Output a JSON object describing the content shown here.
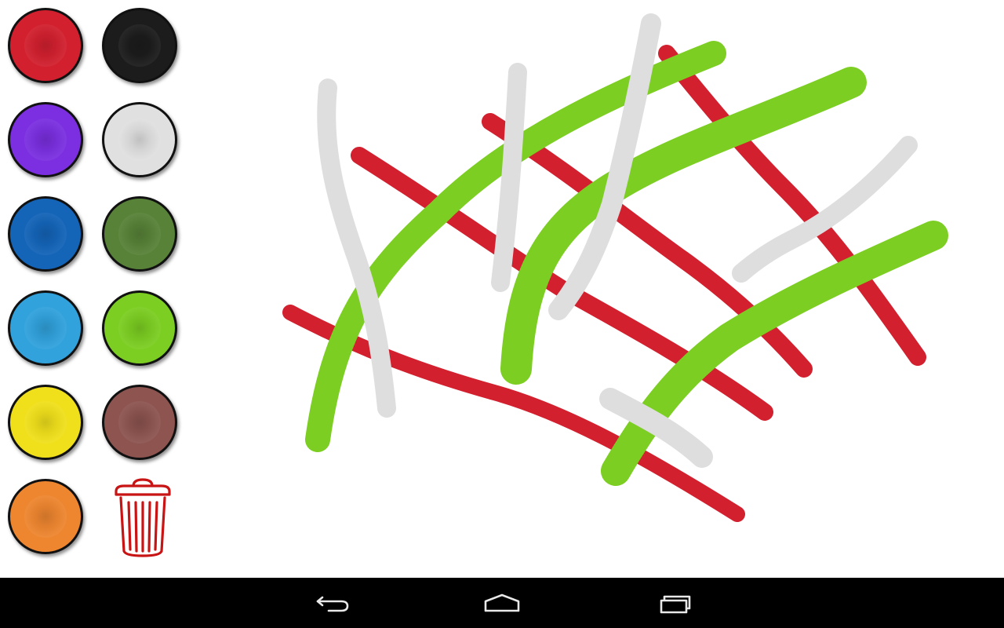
{
  "palette": {
    "colors": [
      {
        "name": "red",
        "hex": "#d2202f"
      },
      {
        "name": "black",
        "hex": "#1c1c1c"
      },
      {
        "name": "purple",
        "hex": "#7b2fe0"
      },
      {
        "name": "light-gray",
        "hex": "#e0e0e0"
      },
      {
        "name": "dark-blue",
        "hex": "#1464b8"
      },
      {
        "name": "olive-green",
        "hex": "#588238"
      },
      {
        "name": "sky-blue",
        "hex": "#31a2dc"
      },
      {
        "name": "lime-green",
        "hex": "#7cce22"
      },
      {
        "name": "yellow",
        "hex": "#f0e01c"
      },
      {
        "name": "brown",
        "hex": "#8d5450"
      },
      {
        "name": "orange",
        "hex": "#ee8630"
      }
    ],
    "trash_icon": "trash-can-icon",
    "trash_color": "#c81414"
  },
  "canvas": {
    "background": "#ffffff",
    "stroke_colors": {
      "red": "#d2202f",
      "green": "#7cce22",
      "gray": "#dedede"
    }
  },
  "navbar": {
    "buttons": [
      {
        "icon": "back-arrow-icon"
      },
      {
        "icon": "home-icon"
      },
      {
        "icon": "recent-apps-icon"
      }
    ]
  }
}
